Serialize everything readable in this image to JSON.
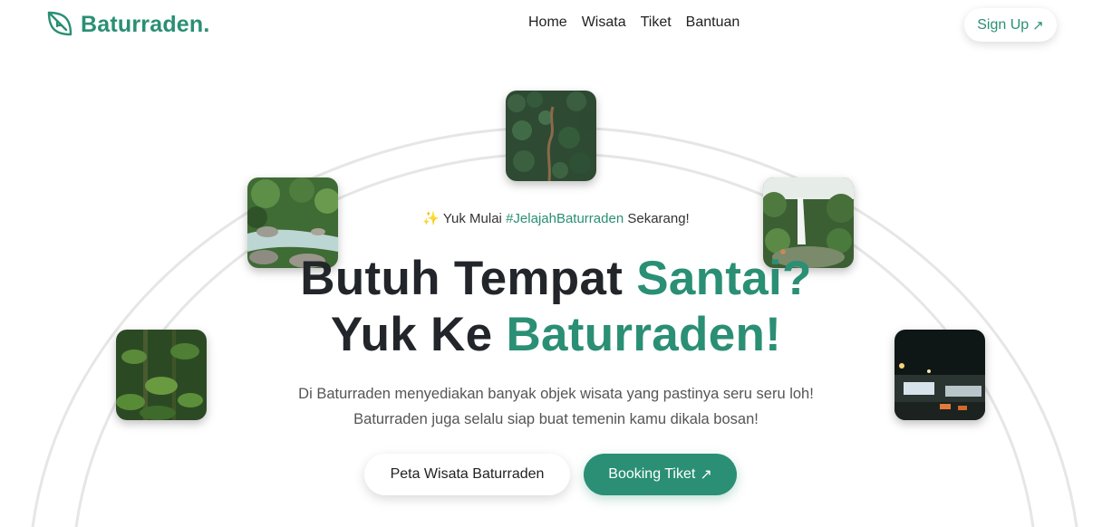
{
  "brand": {
    "name": "Baturraden.",
    "logo_icon": "leaf-icon",
    "accent": "#2a8f74"
  },
  "nav": {
    "items": [
      "Home",
      "Wisata",
      "Tiket",
      "Bantuan"
    ]
  },
  "signup": {
    "label": "Sign Up",
    "icon": "arrow-up-right-icon"
  },
  "hero": {
    "tagline_emoji": "✨",
    "tagline_prefix": "Yuk Mulai",
    "tagline_hashtag": "#JelajahBaturraden",
    "tagline_suffix": "Sekarang!",
    "headline_line1_a": "Butuh Tempat",
    "headline_line1_b": "Santai?",
    "headline_line2_a": "Yuk Ke",
    "headline_line2_b": "Baturraden!",
    "desc_line1": "Di Baturraden menyediakan banyak objek wisata yang pastinya seru seru loh!",
    "desc_line2": "Baturraden juga selalu siap buat temenin kamu dikala bosan!"
  },
  "buttons": {
    "map_label": "Peta Wisata Baturraden",
    "booking_label": "Booking Tiket",
    "booking_icon": "arrow-up-right-icon"
  },
  "photos": [
    "forest-road-photo",
    "river-photo",
    "waterfall-photo",
    "jungle-photo",
    "night-street-photo"
  ]
}
